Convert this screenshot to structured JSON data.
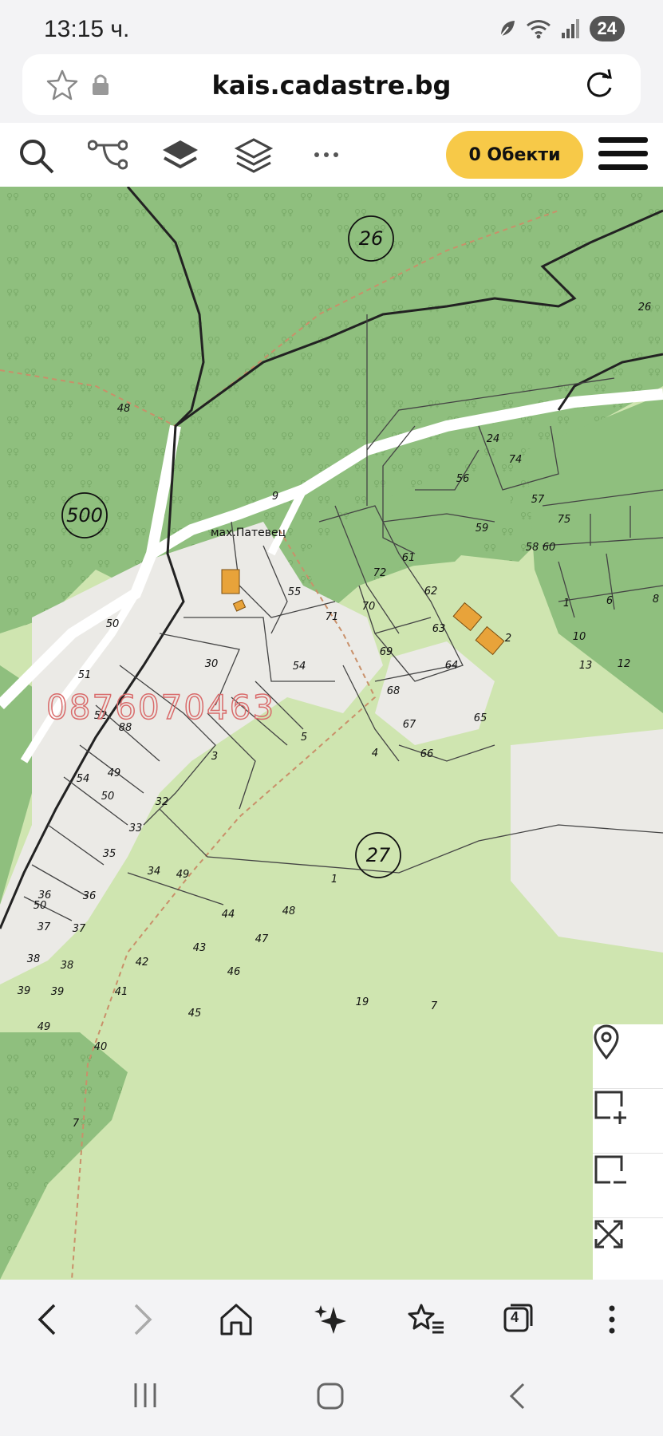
{
  "status": {
    "time": "13:15 ч.",
    "battery": "24"
  },
  "browser": {
    "url": "kais.cadastre.bg",
    "tabs_count": "4"
  },
  "toolbar": {
    "objects_label": "0 Обекти"
  },
  "map": {
    "place_label": "мах.Патевец",
    "watermark": "0876070463",
    "circled_labels": [
      "26",
      "500",
      "27"
    ],
    "parcel_labels": [
      {
        "text": "48"
      },
      {
        "text": "9"
      },
      {
        "text": "26"
      },
      {
        "text": "24"
      },
      {
        "text": "74"
      },
      {
        "text": "56"
      },
      {
        "text": "57"
      },
      {
        "text": "59"
      },
      {
        "text": "60"
      },
      {
        "text": "61"
      },
      {
        "text": "58"
      },
      {
        "text": "75"
      },
      {
        "text": "72"
      },
      {
        "text": "62"
      },
      {
        "text": "70"
      },
      {
        "text": "71"
      },
      {
        "text": "55"
      },
      {
        "text": "63"
      },
      {
        "text": "69"
      },
      {
        "text": "2"
      },
      {
        "text": "1"
      },
      {
        "text": "6"
      },
      {
        "text": "8"
      },
      {
        "text": "10"
      },
      {
        "text": "13"
      },
      {
        "text": "12"
      },
      {
        "text": "64"
      },
      {
        "text": "68"
      },
      {
        "text": "65"
      },
      {
        "text": "67"
      },
      {
        "text": "66"
      },
      {
        "text": "30"
      },
      {
        "text": "54"
      },
      {
        "text": "50"
      },
      {
        "text": "51"
      },
      {
        "text": "52"
      },
      {
        "text": "88"
      },
      {
        "text": "3"
      },
      {
        "text": "5"
      },
      {
        "text": "4"
      },
      {
        "text": "54"
      },
      {
        "text": "49"
      },
      {
        "text": "50"
      },
      {
        "text": "32"
      },
      {
        "text": "33"
      },
      {
        "text": "35"
      },
      {
        "text": "34"
      },
      {
        "text": "49"
      },
      {
        "text": "36"
      },
      {
        "text": "36"
      },
      {
        "text": "50"
      },
      {
        "text": "37"
      },
      {
        "text": "37"
      },
      {
        "text": "38"
      },
      {
        "text": "38"
      },
      {
        "text": "39"
      },
      {
        "text": "39"
      },
      {
        "text": "49"
      },
      {
        "text": "41"
      },
      {
        "text": "40"
      },
      {
        "text": "42"
      },
      {
        "text": "43"
      },
      {
        "text": "44"
      },
      {
        "text": "45"
      },
      {
        "text": "46"
      },
      {
        "text": "47"
      },
      {
        "text": "48"
      },
      {
        "text": "1"
      },
      {
        "text": "19"
      },
      {
        "text": "7"
      },
      {
        "text": "7"
      }
    ]
  },
  "map_controls": [
    "location-pin",
    "add-area",
    "remove-area",
    "fullscreen"
  ],
  "colors": {
    "forest": "#8fbf7e",
    "meadow": "#cfe5b0",
    "built": "#ebeae6",
    "accent": "#f7c948",
    "building": "#e8a33a"
  }
}
